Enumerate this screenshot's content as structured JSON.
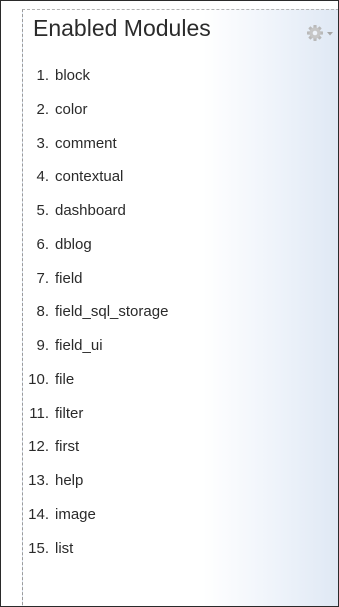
{
  "block": {
    "title": "Enabled Modules",
    "gear_icon": "gear-icon"
  },
  "modules": [
    {
      "num": "1.",
      "name": "block"
    },
    {
      "num": "2.",
      "name": "color"
    },
    {
      "num": "3.",
      "name": "comment"
    },
    {
      "num": "4.",
      "name": "contextual"
    },
    {
      "num": "5.",
      "name": "dashboard"
    },
    {
      "num": "6.",
      "name": "dblog"
    },
    {
      "num": "7.",
      "name": "field"
    },
    {
      "num": "8.",
      "name": "field_sql_storage"
    },
    {
      "num": "9.",
      "name": "field_ui"
    },
    {
      "num": "10.",
      "name": "file"
    },
    {
      "num": "11.",
      "name": "filter"
    },
    {
      "num": "12.",
      "name": "first"
    },
    {
      "num": "13.",
      "name": "help"
    },
    {
      "num": "14.",
      "name": "image"
    },
    {
      "num": "15.",
      "name": "list"
    }
  ],
  "colors": {
    "text": "#2a2a2a",
    "panel_tint": "#dfe8f4",
    "dashed_border": "#9c9c9c"
  }
}
